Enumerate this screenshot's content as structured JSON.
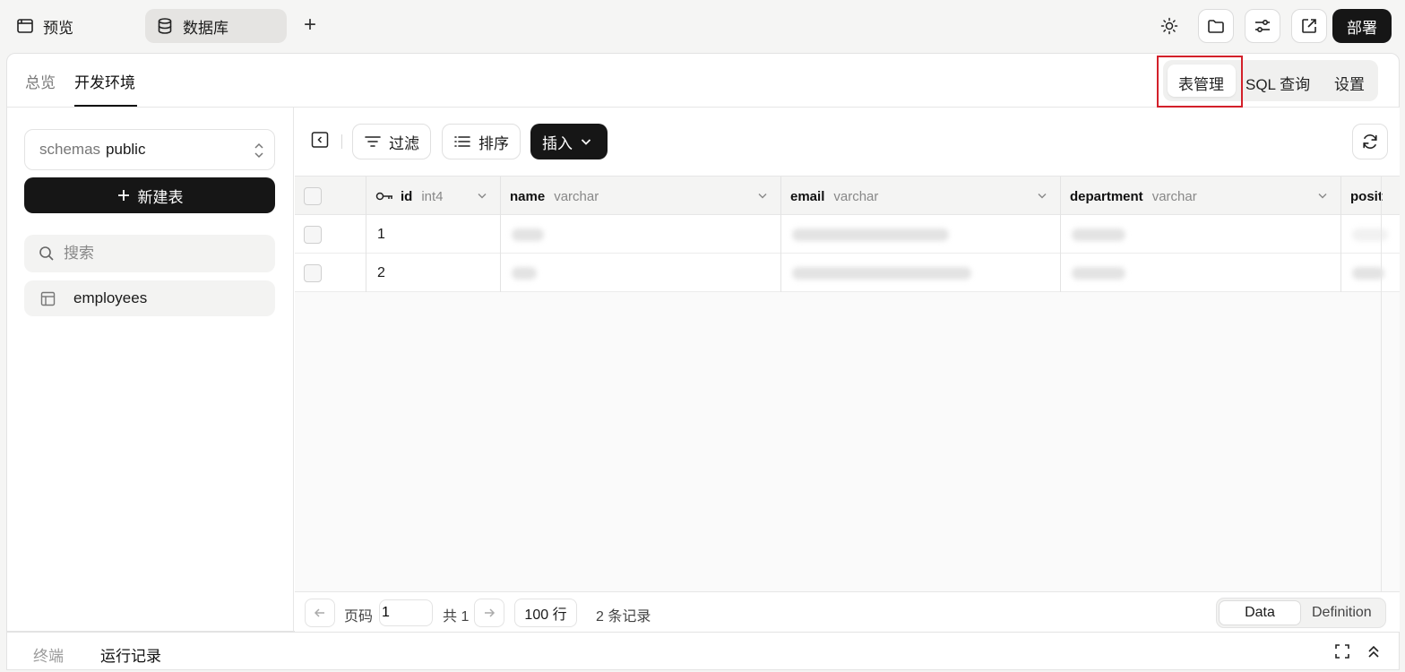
{
  "topbar": {
    "tabs": [
      {
        "label": "预览",
        "icon": "window-icon"
      },
      {
        "label": "数据库",
        "icon": "database-icon"
      }
    ],
    "add_tab": "+",
    "deploy_label": "部署",
    "icons": [
      "sun-icon",
      "folder-icon",
      "sliders-icon",
      "external-link-icon"
    ]
  },
  "subnav": {
    "tabs": [
      "总览",
      "开发环境"
    ],
    "active_tab": "开发环境",
    "segments": [
      "表管理",
      "SQL 查询",
      "设置"
    ],
    "active_segment": "表管理"
  },
  "sidebar": {
    "schema_prefix": "schemas",
    "schema_value": "public",
    "new_table_label": "新建表",
    "search_placeholder": "搜索",
    "tables": [
      "employees"
    ]
  },
  "toolbar": {
    "filter_label": "过滤",
    "sort_label": "排序",
    "insert_label": "插入"
  },
  "grid": {
    "columns": [
      {
        "name": "id",
        "type": "int4",
        "primary_key": true
      },
      {
        "name": "name",
        "type": "varchar"
      },
      {
        "name": "email",
        "type": "varchar"
      },
      {
        "name": "department",
        "type": "varchar"
      },
      {
        "name": "posit",
        "type": ""
      }
    ],
    "rows": [
      {
        "id": "1"
      },
      {
        "id": "2"
      }
    ]
  },
  "pager": {
    "page_label": "页码",
    "page_value": "1",
    "total_label": "共 1",
    "rows_per_page": "100 行",
    "record_count": "2 条记录",
    "views": [
      "Data",
      "Definition"
    ],
    "active_view": "Data"
  },
  "bottom": {
    "tabs": [
      "终端",
      "运行记录"
    ],
    "active_tab": "运行记录"
  },
  "colors": {
    "accent_dark": "#161616",
    "highlight_red": "#d3202a"
  }
}
